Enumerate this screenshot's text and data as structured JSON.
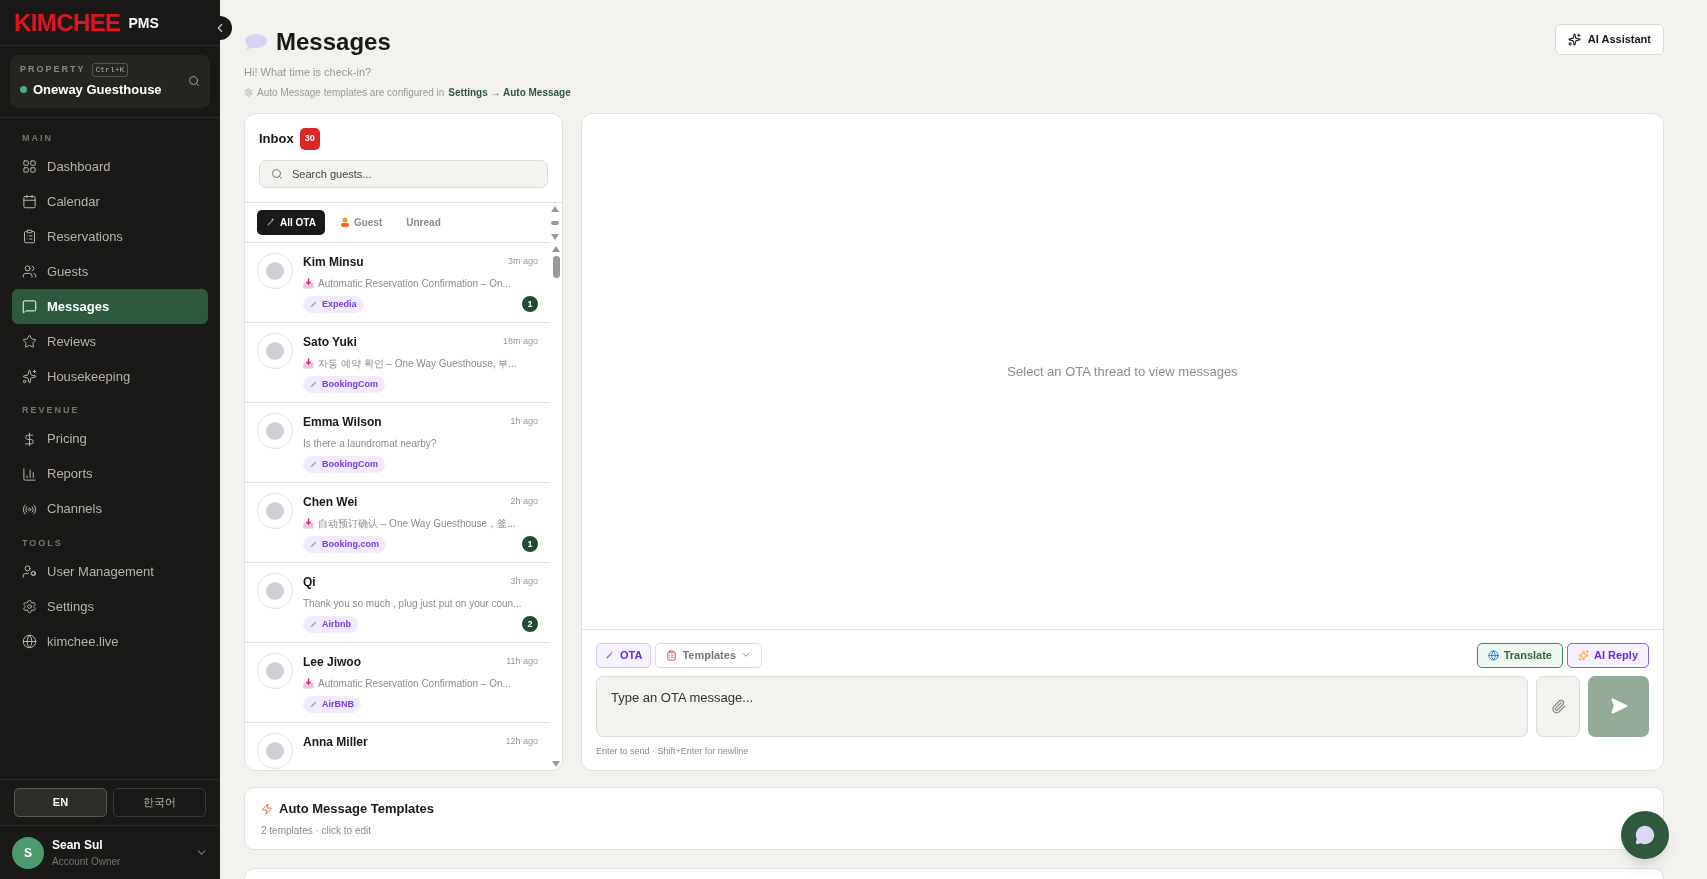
{
  "sidebar": {
    "logo": "KIMCHEE",
    "logo_suffix": "PMS",
    "property": {
      "label": "PROPERTY",
      "shortcut": "Ctrl+K",
      "name": "Oneway Guesthouse"
    },
    "sections": [
      {
        "title": "MAIN",
        "items": [
          {
            "label": "Dashboard",
            "selected": false
          },
          {
            "label": "Calendar",
            "selected": false
          },
          {
            "label": "Reservations",
            "selected": false
          },
          {
            "label": "Guests",
            "selected": false
          },
          {
            "label": "Messages",
            "selected": true
          },
          {
            "label": "Reviews",
            "selected": false
          },
          {
            "label": "Housekeeping",
            "selected": false
          }
        ]
      },
      {
        "title": "REVENUE",
        "items": [
          {
            "label": "Pricing",
            "selected": false
          },
          {
            "label": "Reports",
            "selected": false
          },
          {
            "label": "Channels",
            "selected": false
          }
        ]
      },
      {
        "title": "TOOLS",
        "items": [
          {
            "label": "User Management",
            "selected": false
          },
          {
            "label": "Settings",
            "selected": false
          },
          {
            "label": "kimchee.live",
            "selected": false
          }
        ]
      }
    ],
    "languages": [
      {
        "label": "EN",
        "selected": true
      },
      {
        "label": "한국어",
        "selected": false
      }
    ],
    "user": {
      "initial": "S",
      "name": "Sean Sul",
      "role": "Account Owner"
    }
  },
  "header": {
    "title": "Messages",
    "subtitle": "Hi! What time is check-in?",
    "note": "Auto Message templates are configured in",
    "note_link": "Settings → Auto Message",
    "assistant_button": "AI Assistant"
  },
  "inbox": {
    "title": "Inbox",
    "count": "30",
    "search_placeholder": "Search guests...",
    "filters": [
      {
        "label": "All OTA",
        "selected": true
      },
      {
        "label": "Guest",
        "selected": false
      },
      {
        "label": "Unread",
        "selected": false
      }
    ],
    "threads": [
      {
        "name": "Kim Minsu",
        "time": "3m ago",
        "preview": "Automatic Reservation Confirmation – On...",
        "auto": true,
        "channel": "Expedia",
        "unread": "1"
      },
      {
        "name": "Sato Yuki",
        "time": "18m ago",
        "preview": "자동 예약 확인 – One Way Guesthouse, 부...",
        "auto": true,
        "channel": "BookingCom"
      },
      {
        "name": "Emma Wilson",
        "time": "1h ago",
        "preview": "Is there a laundromat nearby?",
        "auto": false,
        "channel": "BookingCom"
      },
      {
        "name": "Chen Wei",
        "time": "2h ago",
        "preview": "自动预订确认 – One Way Guesthouse，釜...",
        "auto": true,
        "channel": "Booking.com",
        "unread": "1"
      },
      {
        "name": "Qi",
        "time": "3h ago",
        "preview": "Thank you so much , plug just put on your coun...",
        "auto": false,
        "channel": "Airbnb",
        "unread": "2"
      },
      {
        "name": "Lee Jiwoo",
        "time": "11h ago",
        "preview": "Automatic Reservation Confirmation – On...",
        "auto": true,
        "channel": "AirBNB"
      },
      {
        "name": "Anna Miller",
        "time": "12h ago",
        "auto": false
      }
    ]
  },
  "thread": {
    "empty_text": "Select an OTA thread to view messages",
    "composer": {
      "mode": "OTA",
      "templates": "Templates",
      "translate": "Translate",
      "ai_reply": "AI Reply",
      "placeholder": "Type an OTA message...",
      "hint": "Enter to send · Shift+Enter for newline"
    }
  },
  "auto_templates": {
    "title": "Auto Message Templates",
    "subtitle": "2 templates · click to edit"
  }
}
